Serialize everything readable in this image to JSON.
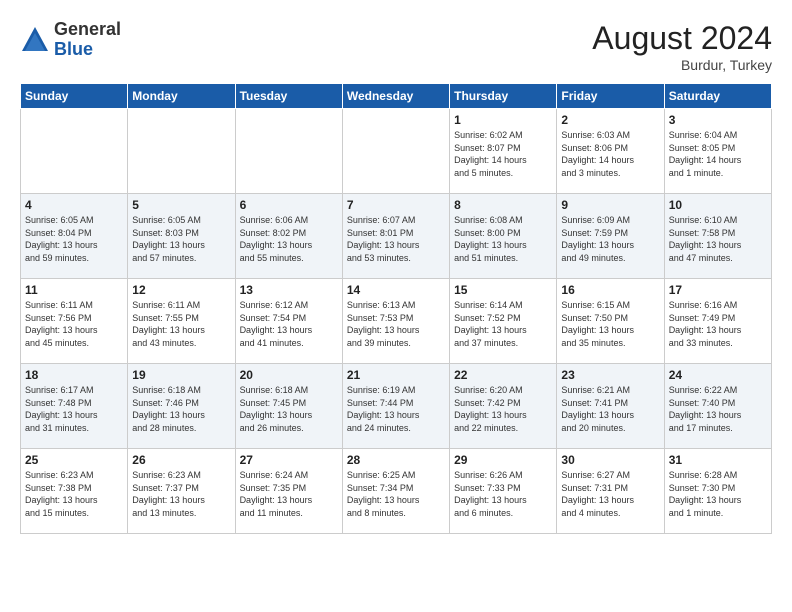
{
  "logo": {
    "general": "General",
    "blue": "Blue"
  },
  "title": {
    "month_year": "August 2024",
    "location": "Burdur, Turkey"
  },
  "headers": [
    "Sunday",
    "Monday",
    "Tuesday",
    "Wednesday",
    "Thursday",
    "Friday",
    "Saturday"
  ],
  "weeks": [
    [
      {
        "day": "",
        "info": ""
      },
      {
        "day": "",
        "info": ""
      },
      {
        "day": "",
        "info": ""
      },
      {
        "day": "",
        "info": ""
      },
      {
        "day": "1",
        "info": "Sunrise: 6:02 AM\nSunset: 8:07 PM\nDaylight: 14 hours\nand 5 minutes."
      },
      {
        "day": "2",
        "info": "Sunrise: 6:03 AM\nSunset: 8:06 PM\nDaylight: 14 hours\nand 3 minutes."
      },
      {
        "day": "3",
        "info": "Sunrise: 6:04 AM\nSunset: 8:05 PM\nDaylight: 14 hours\nand 1 minute."
      }
    ],
    [
      {
        "day": "4",
        "info": "Sunrise: 6:05 AM\nSunset: 8:04 PM\nDaylight: 13 hours\nand 59 minutes."
      },
      {
        "day": "5",
        "info": "Sunrise: 6:05 AM\nSunset: 8:03 PM\nDaylight: 13 hours\nand 57 minutes."
      },
      {
        "day": "6",
        "info": "Sunrise: 6:06 AM\nSunset: 8:02 PM\nDaylight: 13 hours\nand 55 minutes."
      },
      {
        "day": "7",
        "info": "Sunrise: 6:07 AM\nSunset: 8:01 PM\nDaylight: 13 hours\nand 53 minutes."
      },
      {
        "day": "8",
        "info": "Sunrise: 6:08 AM\nSunset: 8:00 PM\nDaylight: 13 hours\nand 51 minutes."
      },
      {
        "day": "9",
        "info": "Sunrise: 6:09 AM\nSunset: 7:59 PM\nDaylight: 13 hours\nand 49 minutes."
      },
      {
        "day": "10",
        "info": "Sunrise: 6:10 AM\nSunset: 7:58 PM\nDaylight: 13 hours\nand 47 minutes."
      }
    ],
    [
      {
        "day": "11",
        "info": "Sunrise: 6:11 AM\nSunset: 7:56 PM\nDaylight: 13 hours\nand 45 minutes."
      },
      {
        "day": "12",
        "info": "Sunrise: 6:11 AM\nSunset: 7:55 PM\nDaylight: 13 hours\nand 43 minutes."
      },
      {
        "day": "13",
        "info": "Sunrise: 6:12 AM\nSunset: 7:54 PM\nDaylight: 13 hours\nand 41 minutes."
      },
      {
        "day": "14",
        "info": "Sunrise: 6:13 AM\nSunset: 7:53 PM\nDaylight: 13 hours\nand 39 minutes."
      },
      {
        "day": "15",
        "info": "Sunrise: 6:14 AM\nSunset: 7:52 PM\nDaylight: 13 hours\nand 37 minutes."
      },
      {
        "day": "16",
        "info": "Sunrise: 6:15 AM\nSunset: 7:50 PM\nDaylight: 13 hours\nand 35 minutes."
      },
      {
        "day": "17",
        "info": "Sunrise: 6:16 AM\nSunset: 7:49 PM\nDaylight: 13 hours\nand 33 minutes."
      }
    ],
    [
      {
        "day": "18",
        "info": "Sunrise: 6:17 AM\nSunset: 7:48 PM\nDaylight: 13 hours\nand 31 minutes."
      },
      {
        "day": "19",
        "info": "Sunrise: 6:18 AM\nSunset: 7:46 PM\nDaylight: 13 hours\nand 28 minutes."
      },
      {
        "day": "20",
        "info": "Sunrise: 6:18 AM\nSunset: 7:45 PM\nDaylight: 13 hours\nand 26 minutes."
      },
      {
        "day": "21",
        "info": "Sunrise: 6:19 AM\nSunset: 7:44 PM\nDaylight: 13 hours\nand 24 minutes."
      },
      {
        "day": "22",
        "info": "Sunrise: 6:20 AM\nSunset: 7:42 PM\nDaylight: 13 hours\nand 22 minutes."
      },
      {
        "day": "23",
        "info": "Sunrise: 6:21 AM\nSunset: 7:41 PM\nDaylight: 13 hours\nand 20 minutes."
      },
      {
        "day": "24",
        "info": "Sunrise: 6:22 AM\nSunset: 7:40 PM\nDaylight: 13 hours\nand 17 minutes."
      }
    ],
    [
      {
        "day": "25",
        "info": "Sunrise: 6:23 AM\nSunset: 7:38 PM\nDaylight: 13 hours\nand 15 minutes."
      },
      {
        "day": "26",
        "info": "Sunrise: 6:23 AM\nSunset: 7:37 PM\nDaylight: 13 hours\nand 13 minutes."
      },
      {
        "day": "27",
        "info": "Sunrise: 6:24 AM\nSunset: 7:35 PM\nDaylight: 13 hours\nand 11 minutes."
      },
      {
        "day": "28",
        "info": "Sunrise: 6:25 AM\nSunset: 7:34 PM\nDaylight: 13 hours\nand 8 minutes."
      },
      {
        "day": "29",
        "info": "Sunrise: 6:26 AM\nSunset: 7:33 PM\nDaylight: 13 hours\nand 6 minutes."
      },
      {
        "day": "30",
        "info": "Sunrise: 6:27 AM\nSunset: 7:31 PM\nDaylight: 13 hours\nand 4 minutes."
      },
      {
        "day": "31",
        "info": "Sunrise: 6:28 AM\nSunset: 7:30 PM\nDaylight: 13 hours\nand 1 minute."
      }
    ]
  ]
}
